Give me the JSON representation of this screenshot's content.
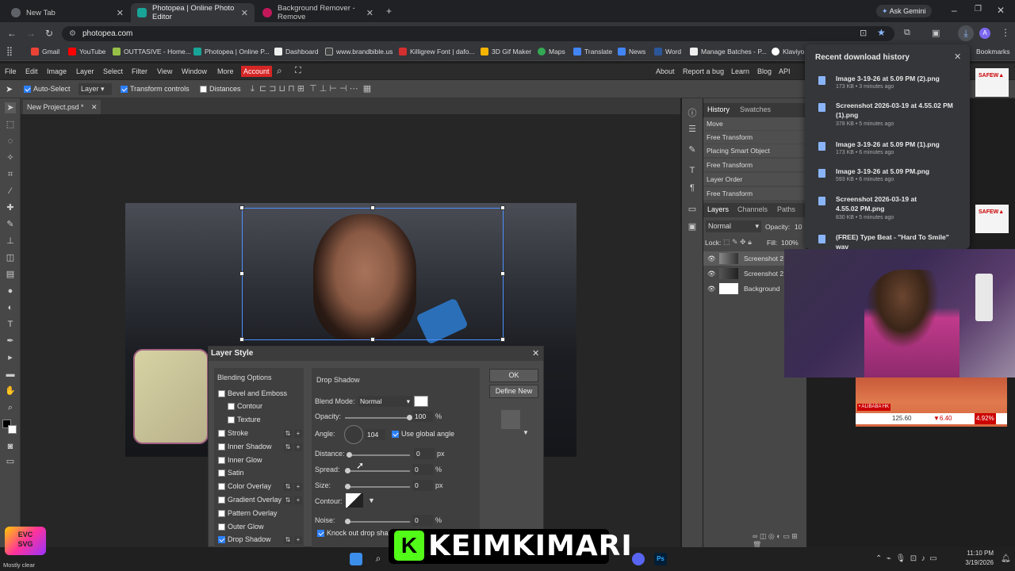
{
  "browser": {
    "tabs": [
      {
        "label": "New Tab",
        "color": "#5f6368"
      },
      {
        "label": "Photopea | Online Photo Editor",
        "color": "#18a497"
      },
      {
        "label": "Background Remover - Remove",
        "color": "#c2185b"
      }
    ],
    "url": "photopea.com",
    "gemini": "Ask Gemini",
    "profile": "A",
    "bookmarks": [
      "Gmail",
      "YouTube",
      "OUTTASIVE - Home...",
      "Photopea | Online P...",
      "Dashboard",
      "www.brandbible.us",
      "Killigrew Font | dafo...",
      "3D Gif Maker",
      "Maps",
      "Translate",
      "News",
      "Word",
      "Manage Batches - P...",
      "Klaviyo"
    ],
    "all_bookmarks": "Bookmarks"
  },
  "downloads": {
    "title": "Recent download history",
    "items": [
      {
        "name": "Image 3-19-26 at 5.09 PM (2).png",
        "meta": "173 KB • 3 minutes ago"
      },
      {
        "name": "Screenshot 2026-03-19 at 4.55.02 PM (1).png",
        "meta": "378 KB • 5 minutes ago"
      },
      {
        "name": "Image 3-19-26 at 5.09 PM (1).png",
        "meta": "173 KB • 6 minutes ago"
      },
      {
        "name": "Image 3-19-26 at 5.09 PM.png",
        "meta": "593 KB • 6 minutes ago"
      },
      {
        "name": "Screenshot 2026-03-19 at 4.55.02 PM.png",
        "meta": "830 KB • 5 minutes ago"
      },
      {
        "name": "(FREE) Type Beat - \"Hard To Smile\" wav",
        "meta": ""
      }
    ]
  },
  "photopea": {
    "menu": [
      "File",
      "Edit",
      "Image",
      "Layer",
      "Select",
      "Filter",
      "View",
      "Window",
      "More"
    ],
    "account": "Account",
    "right_menu": [
      "About",
      "Report a bug",
      "Learn",
      "Blog",
      "API"
    ],
    "toolbar": {
      "auto_select": "Auto-Select",
      "layer_select": "Layer",
      "transform_controls": "Transform controls",
      "distances": "Distances"
    },
    "doc_tab": "New Project.psd *",
    "history_tabs": [
      "History",
      "Swatches"
    ],
    "history": [
      "Move",
      "Free Transform",
      "Placing Smart Object",
      "Free Transform",
      "Layer Order",
      "Free Transform"
    ],
    "layers_tabs": [
      "Layers",
      "Channels",
      "Paths"
    ],
    "blend": "Normal",
    "opacity_label": "Opacity:",
    "opacity_val": "10",
    "lock_label": "Lock:",
    "fill_label": "Fill:",
    "fill_val": "100%",
    "layers": [
      "Screenshot 2",
      "Screenshot 2",
      "Background"
    ]
  },
  "dialog": {
    "title": "Layer Style",
    "left_items": [
      {
        "label": "Blending Options",
        "check": null,
        "pm": false
      },
      {
        "label": "Bevel and Emboss",
        "check": false,
        "pm": false
      },
      {
        "label": "Contour",
        "check": false,
        "pm": false,
        "indent": true
      },
      {
        "label": "Texture",
        "check": false,
        "pm": false,
        "indent": true
      },
      {
        "label": "Stroke",
        "check": false,
        "pm": true
      },
      {
        "label": "Inner Shadow",
        "check": false,
        "pm": true
      },
      {
        "label": "Inner Glow",
        "check": false,
        "pm": false
      },
      {
        "label": "Satin",
        "check": false,
        "pm": false
      },
      {
        "label": "Color Overlay",
        "check": false,
        "pm": true
      },
      {
        "label": "Gradient Overlay",
        "check": false,
        "pm": true
      },
      {
        "label": "Pattern Overlay",
        "check": false,
        "pm": false
      },
      {
        "label": "Outer Glow",
        "check": false,
        "pm": false
      },
      {
        "label": "Drop Shadow",
        "check": true,
        "pm": true
      }
    ],
    "section": "Drop Shadow",
    "blend_mode_label": "Blend Mode:",
    "blend_mode": "Normal",
    "opacity_label": "Opacity:",
    "opacity": "100",
    "angle_label": "Angle:",
    "angle": "104",
    "global_angle": "Use global angle",
    "distance_label": "Distance:",
    "distance": "0",
    "spread_label": "Spread:",
    "spread": "0",
    "size_label": "Size:",
    "size": "0",
    "contour_label": "Contour:",
    "noise_label": "Noise:",
    "noise": "0",
    "knockout": "Knock out drop sha",
    "unit_px": "px",
    "unit_pct": "%",
    "ok": "OK",
    "define_new": "Define New"
  },
  "stream": {
    "overlay_name": "KEIMKIMARI",
    "ticker": [
      "125.60",
      "▼6.40",
      "4.92%"
    ],
    "ticker_head": "• ALIBABA HK"
  },
  "taskbar": {
    "weather": "Mostly clear",
    "time": "11:10 PM",
    "date": "3/19/2026"
  }
}
